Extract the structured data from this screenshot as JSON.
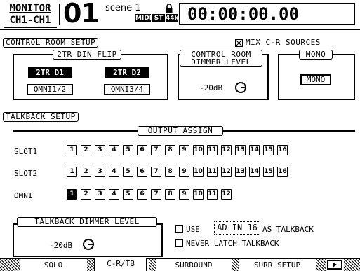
{
  "header": {
    "title_line1": "MONITOR",
    "title_line2": "CH1-CH1",
    "scene_number": "01",
    "scene_label": "scene 1",
    "badges": [
      "MIDI",
      "ST",
      "44k"
    ],
    "timecode": "00:00:00.00",
    "lock_icon": "lock-icon"
  },
  "control_room": {
    "section_label": "CONTROL ROOM SETUP",
    "mix_cr_label": "MIX C-R SOURCES",
    "mix_cr_checked": true,
    "din_flip": {
      "label": "2TR DIN FLIP",
      "buttons": [
        "2TR D1",
        "2TR D2",
        "OMNI1/2",
        "OMNI3/4"
      ]
    },
    "dimmer": {
      "label_line1": "CONTROL ROOM",
      "label_line2": "DIMMER LEVEL",
      "value": "-20dB"
    },
    "mono": {
      "label": "MONO",
      "button": "MONO"
    }
  },
  "talkback": {
    "section_label": "TALKBACK SETUP",
    "output_assign_label": "OUTPUT ASSIGN",
    "rows": [
      {
        "label": "SLOT1",
        "buttons": [
          "1",
          "2",
          "3",
          "4",
          "5",
          "6",
          "7",
          "8",
          "9",
          "10",
          "11",
          "12",
          "13",
          "14",
          "15",
          "16"
        ]
      },
      {
        "label": "SLOT2",
        "buttons": [
          "1",
          "2",
          "3",
          "4",
          "5",
          "6",
          "7",
          "8",
          "9",
          "10",
          "11",
          "12",
          "13",
          "14",
          "15",
          "16"
        ]
      },
      {
        "label": "OMNI",
        "buttons": [
          "1",
          "2",
          "3",
          "4",
          "5",
          "6",
          "7",
          "8",
          "9",
          "10",
          "11",
          "12"
        ],
        "selected": "1"
      }
    ],
    "dimmer_label": "TALKBACK DIMMER LEVEL",
    "dimmer_value": "-20dB",
    "use_prefix": "USE",
    "use_source": "AD IN 16",
    "use_suffix": "AS TALKBACK",
    "use_checked": false,
    "never_latch_label": "NEVER LATCH TALKBACK",
    "never_latch_checked": false
  },
  "tabs": [
    "SOLO",
    "C-R/TB",
    "SURROUND",
    "SURR SETUP"
  ],
  "active_tab": "C-R/TB"
}
